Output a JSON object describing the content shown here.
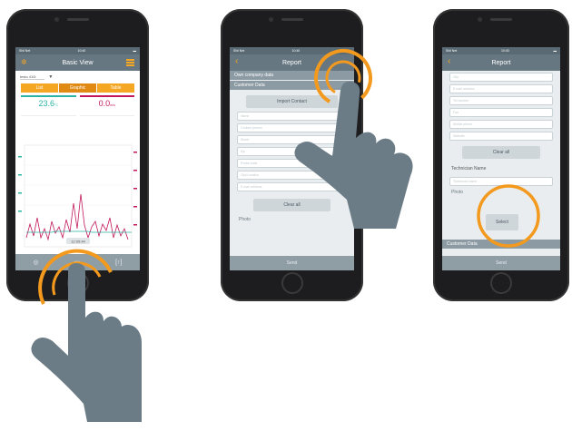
{
  "phone1": {
    "status_left": "Shll Net",
    "status_time": "10:40",
    "nav_title": "Basic View",
    "device_select": "testo 410i",
    "tabs": [
      "List",
      "Graphic",
      "Table"
    ],
    "reading1_value": "23.6",
    "reading1_unit": "°C",
    "reading2_value": "0.0",
    "reading2_unit": "m/s",
    "chart_tooltip": "12:05:44"
  },
  "phone2": {
    "status_left": "Shll Net",
    "status_time": "10:40",
    "nav_title": "Report",
    "section_own": "Own company data",
    "section_customer": "Customer Data",
    "import_label": "Import Contact",
    "fields": [
      "Name",
      "Contact person",
      "Street",
      "Zip",
      "Postal code",
      "City/Location",
      "E-mail address"
    ],
    "clear_label": "Clear all",
    "photo_label": "Photo",
    "send_label": "Send"
  },
  "phone3": {
    "status_left": "Shll Net",
    "status_time": "10:40",
    "nav_title": "Report",
    "fields": [
      "City",
      "E-mail address",
      "Tel number",
      "Fax",
      "Mobile phone",
      "Website"
    ],
    "clear_label": "Clear all",
    "technician_label": "Technician Name",
    "technician_placeholder": "Technician name",
    "photo_label": "Photo",
    "select_label": "Select",
    "section_customer": "Customer Data",
    "send_label": "Send"
  },
  "colors": {
    "accent": "#f39a1e",
    "hand": "#6b7c86",
    "nav": "#677781",
    "teal": "#2bb3a3",
    "magenta": "#c2185b"
  }
}
